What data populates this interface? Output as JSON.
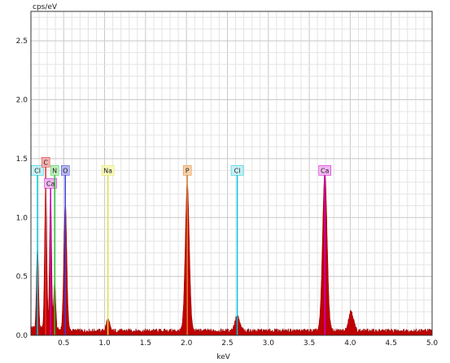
{
  "chart_data": {
    "type": "area",
    "ylabel": "cps/eV",
    "xlabel": "keV",
    "xlim": [
      0.1,
      5.0
    ],
    "ylim": [
      0,
      2.75
    ],
    "x_ticks": [
      "0.5",
      "1.0",
      "1.5",
      "2.0",
      "2.5",
      "3.0",
      "3.5",
      "4.0",
      "4.5",
      "5.0"
    ],
    "y_ticks": [
      "0.0",
      "0.5",
      "1.0",
      "1.5",
      "2.0",
      "2.5"
    ],
    "grid": true,
    "spectrum_color": "#c00000",
    "background_level": 0.04,
    "peaks": [
      {
        "x": 0.18,
        "y": 0.7,
        "width": 0.012
      },
      {
        "x": 0.28,
        "y": 1.25,
        "width": 0.013
      },
      {
        "x": 0.34,
        "y": 1.2,
        "width": 0.012
      },
      {
        "x": 0.39,
        "y": 0.42,
        "width": 0.012
      },
      {
        "x": 0.52,
        "y": 1.1,
        "width": 0.018
      },
      {
        "x": 1.04,
        "y": 0.1,
        "width": 0.02
      },
      {
        "x": 2.01,
        "y": 1.25,
        "width": 0.025
      },
      {
        "x": 2.62,
        "y": 0.12,
        "width": 0.03
      },
      {
        "x": 3.69,
        "y": 1.35,
        "width": 0.028
      },
      {
        "x": 4.01,
        "y": 0.17,
        "width": 0.03
      }
    ],
    "element_markers": [
      {
        "label": "Cl",
        "x": 0.18,
        "color": "#00c8d8",
        "label_bg": "#c8f0f4",
        "label_y": 1.4
      },
      {
        "label": "C",
        "x": 0.28,
        "color": "#e03030",
        "label_bg": "#f4b0b0",
        "label_y": 1.47
      },
      {
        "label": "Ca",
        "x": 0.34,
        "color": "#d000d0",
        "label_bg": "#f0b8f0",
        "label_y": 1.29
      },
      {
        "label": "N",
        "x": 0.39,
        "color": "#30c030",
        "label_bg": "#c0f0c0",
        "label_y": 1.4
      },
      {
        "label": "O",
        "x": 0.52,
        "color": "#4040e0",
        "label_bg": "#b8b8f0",
        "label_y": 1.4
      },
      {
        "label": "Na",
        "x": 1.04,
        "color": "#e0e040",
        "label_bg": "#f8f8c0",
        "label_y": 1.4
      },
      {
        "label": "P",
        "x": 2.01,
        "color": "#e08030",
        "label_bg": "#f8d0a8",
        "label_y": 1.4
      },
      {
        "label": "Cl",
        "x": 2.62,
        "color": "#00c8d8",
        "label_bg": "#c8f0f4",
        "label_y": 1.4
      },
      {
        "label": "Ca",
        "x": 3.69,
        "color": "#d000d0",
        "label_bg": "#f0b8f0",
        "label_y": 1.4
      }
    ]
  }
}
